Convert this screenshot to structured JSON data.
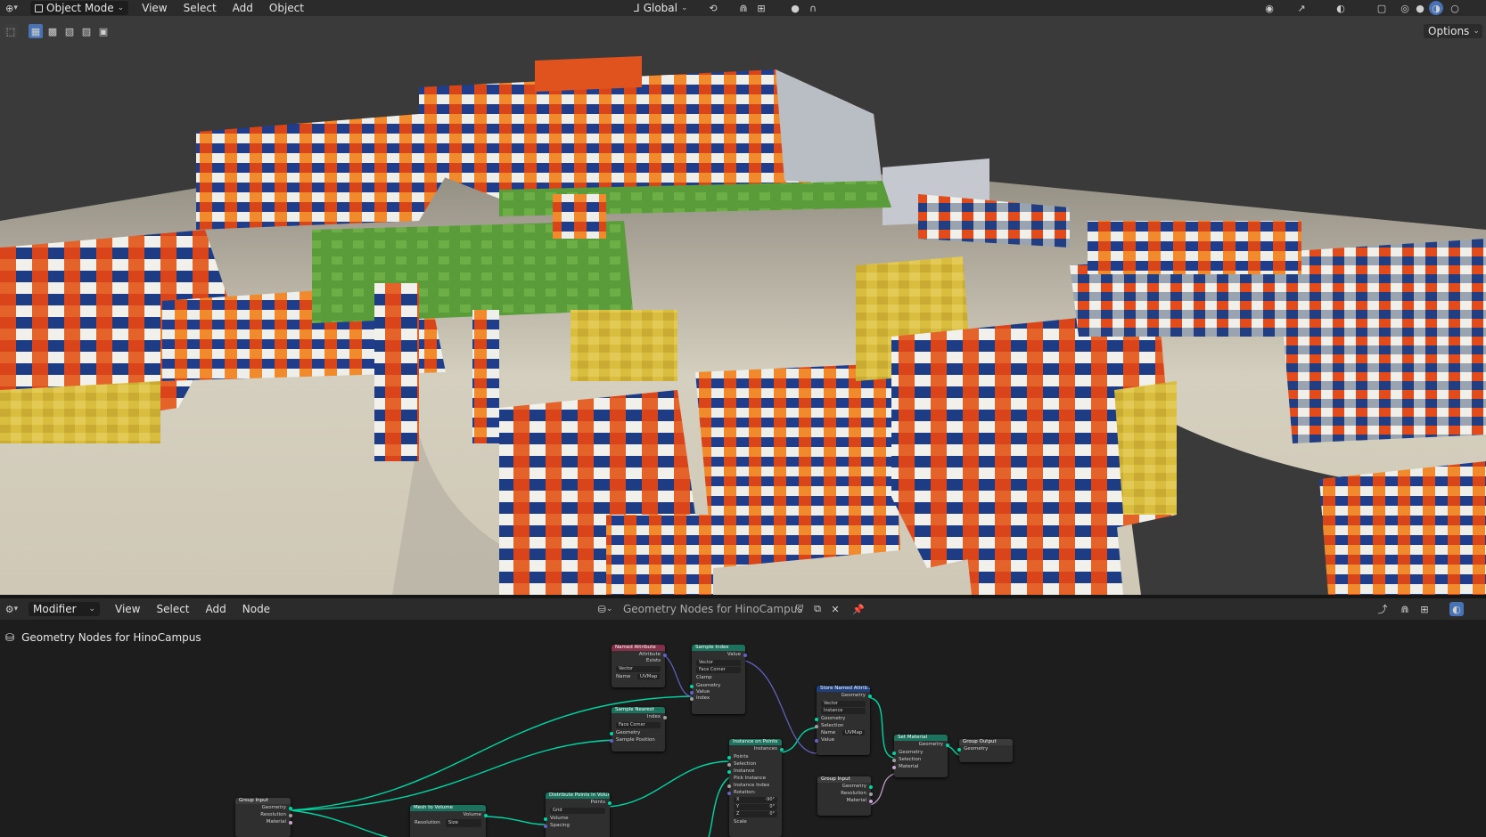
{
  "top_header": {
    "mode": "Object Mode",
    "menus": [
      "View",
      "Select",
      "Add",
      "Object"
    ],
    "orientation": "Global",
    "options_label": "Options"
  },
  "node_header": {
    "editor": "Modifier",
    "menus": [
      "View",
      "Select",
      "Add",
      "Node"
    ],
    "tree_name": "Geometry Nodes for HinoCampus",
    "breadcrumb": "Geometry Nodes for HinoCampus"
  },
  "nodes": {
    "named_attribute": {
      "title": "Named Attribute",
      "out1": "Attribute",
      "out2": "Exists",
      "type": "Vector",
      "name_label": "Name",
      "name_value": "UVMap"
    },
    "sample_index": {
      "title": "Sample Index",
      "out": "Value",
      "type": "Vector",
      "domain": "Face Corner",
      "clamp": "Clamp",
      "in1": "Geometry",
      "in2": "Value",
      "in3": "Index"
    },
    "sample_nearest": {
      "title": "Sample Nearest",
      "out": "Index",
      "domain": "Face Corner",
      "in1": "Geometry",
      "in2": "Sample Position"
    },
    "store_named": {
      "title": "Store Named Attrib...",
      "out": "Geometry",
      "type": "Vector",
      "domain": "Instance",
      "in1": "Geometry",
      "in2": "Selection",
      "name_label": "Name",
      "name_value": "UVMap",
      "in4": "Value"
    },
    "set_material": {
      "title": "Set Material",
      "out": "Geometry",
      "in1": "Geometry",
      "in2": "Selection",
      "in3": "Material"
    },
    "group_output": {
      "title": "Group Output",
      "in1": "Geometry"
    },
    "group_input_right": {
      "title": "Group Input",
      "o1": "Geometry",
      "o2": "Resolution",
      "o3": "Material"
    },
    "instance_on_points": {
      "title": "Instance on Points",
      "out": "Instances",
      "in1": "Points",
      "in2": "Selection",
      "in3": "Instance",
      "in4": "Pick Instance",
      "in5": "Instance Index",
      "in6": "Rotation:",
      "x": "X",
      "xv": "-90°",
      "y": "Y",
      "yv": "0°",
      "z": "Z",
      "zv": "0°",
      "in7": "Scale"
    },
    "distribute": {
      "title": "Distribute Points in Volume",
      "out": "Points",
      "mode": "Grid",
      "in1": "Volume",
      "in2": "Spacing"
    },
    "mesh_to_volume": {
      "title": "Mesh to Volume",
      "out": "Volume",
      "res_label": "Resolution",
      "res_value": "Size"
    },
    "group_input_left": {
      "title": "Group Input",
      "o1": "Geometry",
      "o2": "Resolution",
      "o3": "Material"
    }
  },
  "colors": {
    "geometry_socket": "#00d6a3",
    "vector_socket": "#6363c7",
    "header_attribute": "#83314a",
    "header_geometry": "#1d725e",
    "header_input": "#3c3c3c"
  }
}
